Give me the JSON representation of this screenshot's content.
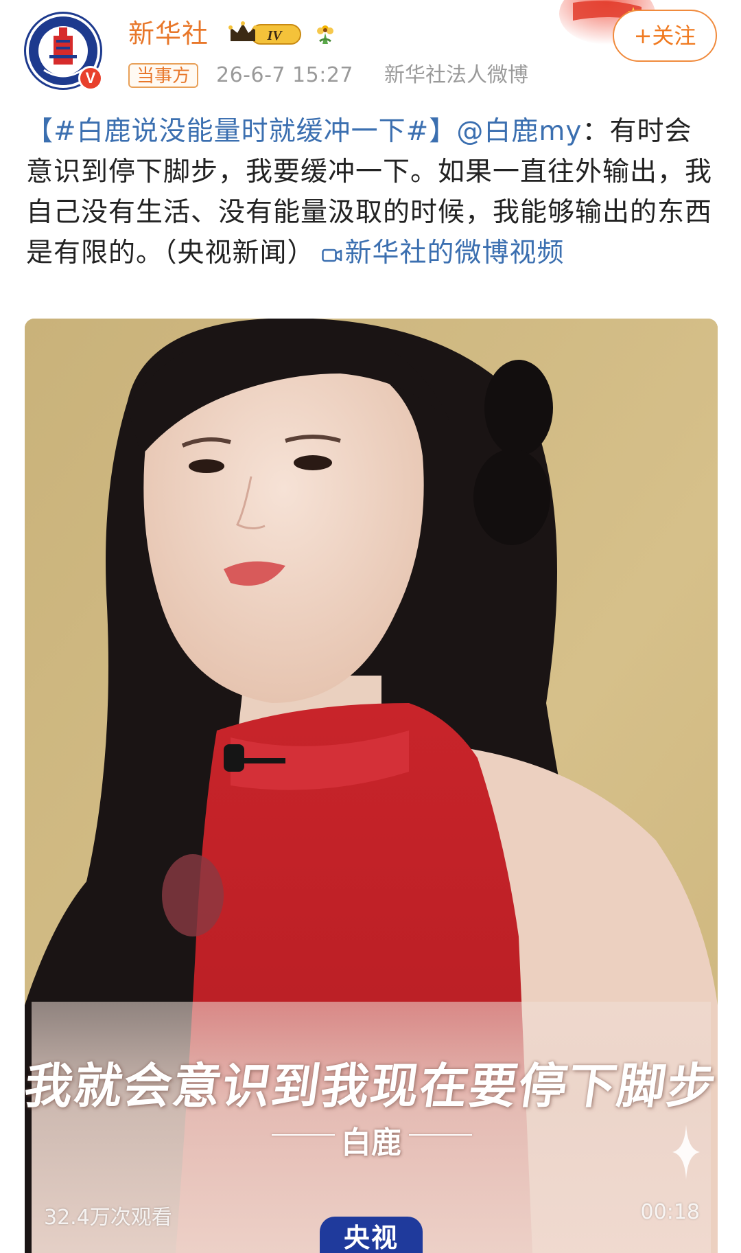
{
  "header": {
    "author_name": "新华社",
    "avatar_text": "XINHUA",
    "verified_mark": "V",
    "level_badge": "IV",
    "tag": "当事方",
    "time": "26-6-7 15:27",
    "source": "新华社法人微博",
    "follow_label": "+关注"
  },
  "post": {
    "topic": "【#白鹿说没能量时就缓冲一下#】",
    "mention": "@白鹿my",
    "body": "：有时会意识到停下脚步，我要缓冲一下。如果一直往外输出，我自己没有生活、没有能量汲取的时候，我能够输出的东西是有限的。（央视新闻）",
    "video_link": "新华社的微博视频"
  },
  "video": {
    "subtitle": "我就会意识到我现在要停下脚步",
    "speaker": "白鹿",
    "views": "32.4万次观看",
    "duration": "00:18",
    "channel_logo": "央视"
  },
  "colors": {
    "author": "#e8772a",
    "link": "#3b6fb0",
    "follow": "#f07a20",
    "meta": "#9a9a9a",
    "verified": "#e8402c"
  },
  "icons": {
    "level_badge": "crown-icon",
    "decoration": "flower-icon",
    "video_link": "video-camera-icon",
    "sparkle": "sparkle-icon"
  }
}
